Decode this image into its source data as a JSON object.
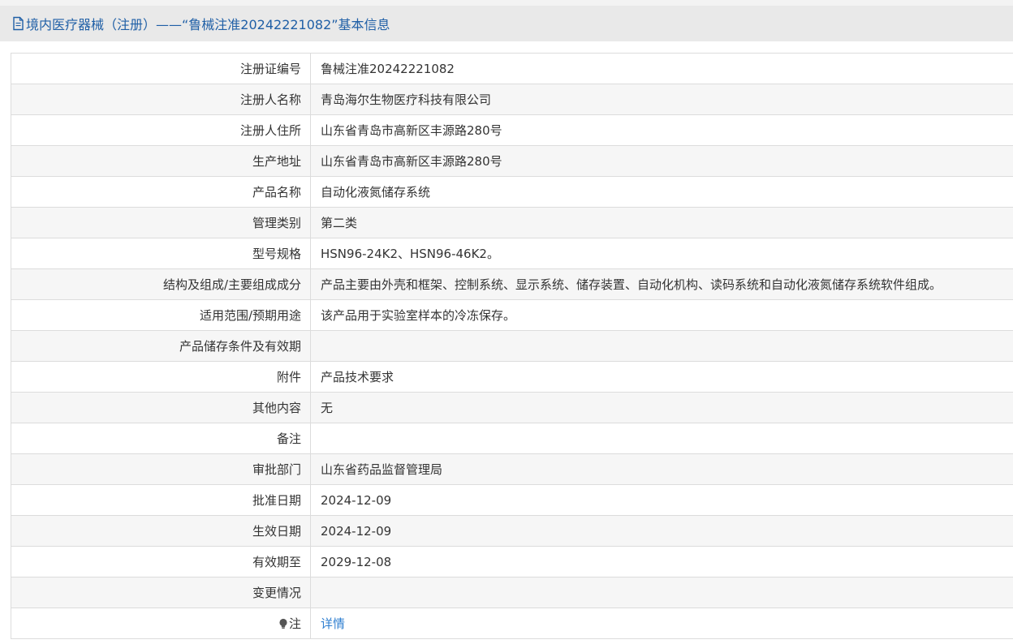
{
  "header": {
    "title": "境内医疗器械（注册）——“鲁械注准20242221082”基本信息"
  },
  "rows": [
    {
      "label": "注册证编号",
      "value": "鲁械注准20242221082"
    },
    {
      "label": "注册人名称",
      "value": "青岛海尔生物医疗科技有限公司"
    },
    {
      "label": "注册人住所",
      "value": "山东省青岛市高新区丰源路280号"
    },
    {
      "label": "生产地址",
      "value": "山东省青岛市高新区丰源路280号"
    },
    {
      "label": "产品名称",
      "value": "自动化液氮储存系统"
    },
    {
      "label": "管理类别",
      "value": "第二类"
    },
    {
      "label": "型号规格",
      "value": "HSN96-24K2、HSN96-46K2。"
    },
    {
      "label": "结构及组成/主要组成成分",
      "value": "产品主要由外壳和框架、控制系统、显示系统、储存装置、自动化机构、读码系统和自动化液氮储存系统软件组成。"
    },
    {
      "label": "适用范围/预期用途",
      "value": "该产品用于实验室样本的冷冻保存。"
    },
    {
      "label": "产品储存条件及有效期",
      "value": ""
    },
    {
      "label": "附件",
      "value": "产品技术要求"
    },
    {
      "label": "其他内容",
      "value": "无"
    },
    {
      "label": "备注",
      "value": ""
    },
    {
      "label": "审批部门",
      "value": "山东省药品监督管理局"
    },
    {
      "label": "批准日期",
      "value": "2024-12-09"
    },
    {
      "label": "生效日期",
      "value": "2024-12-09"
    },
    {
      "label": "有效期至",
      "value": "2029-12-08"
    },
    {
      "label": "变更情况",
      "value": ""
    }
  ],
  "note": {
    "label": "注",
    "link_text": "详情",
    "icon": "lightbulb-icon"
  },
  "colors": {
    "title": "#1f5fa6",
    "link": "#2f7fd0",
    "header_bg": "#e9e9e9",
    "stripe": "#f6f6f6"
  }
}
